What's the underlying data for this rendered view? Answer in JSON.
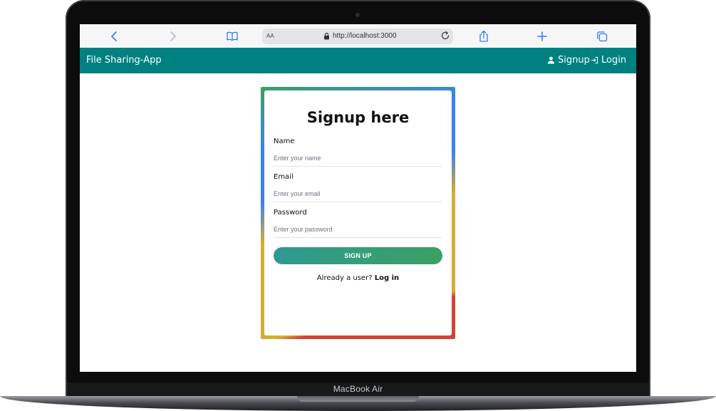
{
  "device": {
    "label": "MacBook Air"
  },
  "browser": {
    "aa_label": "AA",
    "url": "http://localhost:3000"
  },
  "navbar": {
    "brand": "File Sharing-App",
    "signup_label": "Signup",
    "login_label": "Login",
    "background_color": "#008080"
  },
  "signup_form": {
    "title": "Signup here",
    "name": {
      "label": "Name",
      "placeholder": "Enter your name"
    },
    "email": {
      "label": "Email",
      "placeholder": "Enter your email"
    },
    "password": {
      "label": "Password",
      "placeholder": "Enter your password"
    },
    "submit_label": "SIGN UP",
    "already_text": "Already a user?",
    "login_link": "Log in"
  }
}
